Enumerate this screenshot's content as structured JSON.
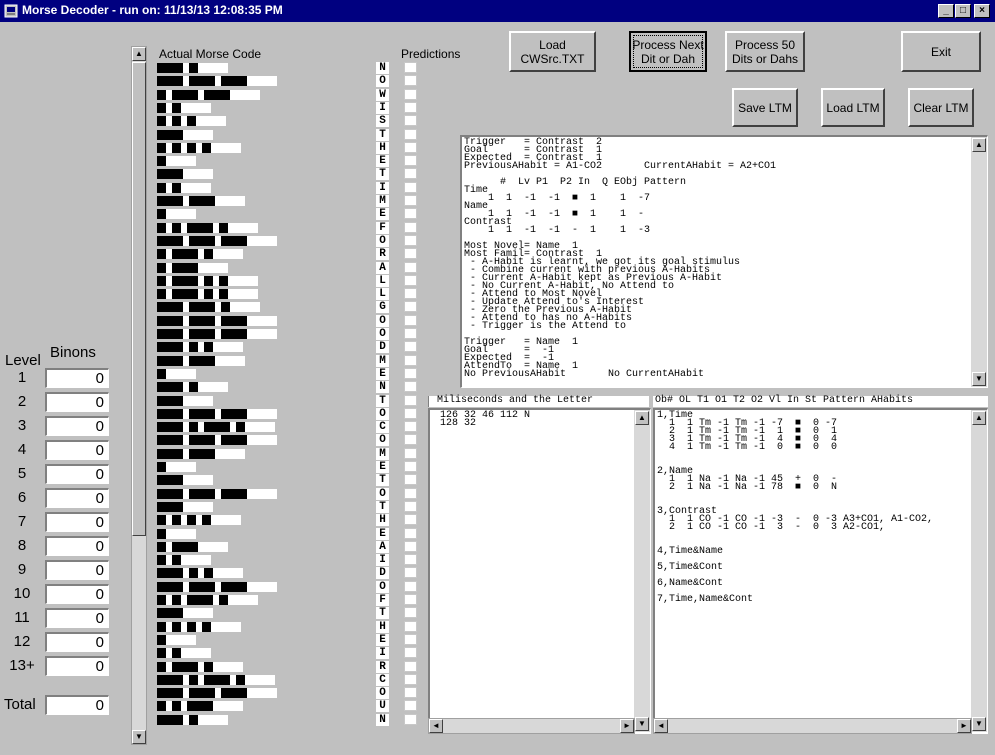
{
  "window": {
    "title": "Morse Decoder - run on: 11/13/13  12:08:35 PM",
    "min": "_",
    "max": "□",
    "close": "×"
  },
  "levels": {
    "header_level": "Level",
    "header_binons": "Binons",
    "rows": [
      {
        "label": "1",
        "value": "0"
      },
      {
        "label": "2",
        "value": "0"
      },
      {
        "label": "3",
        "value": "0"
      },
      {
        "label": "4",
        "value": "0"
      },
      {
        "label": "5",
        "value": "0"
      },
      {
        "label": "6",
        "value": "0"
      },
      {
        "label": "7",
        "value": "0"
      },
      {
        "label": "8",
        "value": "0"
      },
      {
        "label": "9",
        "value": "0"
      },
      {
        "label": "10",
        "value": "0"
      },
      {
        "label": "11",
        "value": "0"
      },
      {
        "label": "12",
        "value": "0"
      },
      {
        "label": "13+",
        "value": "0"
      }
    ],
    "total_label": "Total",
    "total_value": "0"
  },
  "morse": {
    "header": "Actual Morse Code",
    "predictions_header": "Predictions",
    "letters": [
      "N",
      "O",
      "W",
      "I",
      "S",
      "T",
      "H",
      "E",
      "T",
      "I",
      "M",
      "E",
      "F",
      "O",
      "R",
      "A",
      "L",
      "L",
      "G",
      "O",
      "O",
      "D",
      "M",
      "E",
      "N",
      "T",
      "O",
      "C",
      "O",
      "M",
      "E",
      "T",
      "O",
      "T",
      "H",
      "E",
      "A",
      "I",
      "D",
      "O",
      "F",
      "T",
      "H",
      "E",
      "I",
      "R",
      "C",
      "O",
      "U",
      "N"
    ]
  },
  "buttons": {
    "load": "Load\nCWSrc.TXT",
    "next": "Process Next\nDit or Dah",
    "p50": "Process 50\nDits or Dahs",
    "exit": "Exit",
    "save_ltm": "Save LTM",
    "load_ltm": "Load LTM",
    "clear_ltm": "Clear LTM"
  },
  "status_text": "Trigger   = Contrast  2\nGoal      = Contrast  1\nExpected  = Contrast  1\nPreviousAHabit = A1-CO2       CurrentAHabit = A2+CO1\n\n      #  Lv P1  P2 In  Q EObj Pattern\nTime\n    1  1  -1  -1  ■  1    1  -7\nName\n    1  1  -1  -1  ■  1    1  -\nContrast\n    1  1  -1  -1  -  1    1  -3\n\nMost Novel= Name  1\nMost Famil= Contrast  1\n - A-Habit is learnt, we got its goal stimulus\n - Combine current with previous A-Habits\n - Current A-Habit kept as Previous A-Habit\n - No Current A-Habit, No Attend to\n - Attend to Most Novel\n - Update Attend to's Interest\n - Zero the Previous A-Habit\n - Attend to has no A-Habits\n - Trigger is the Attend to\n\nTrigger   = Name  1\nGoal      =  -1\nExpected  =  -1\nAttendTo  = Name  1\nNo PreviousAHabit       No CurrentAHabit",
  "ms_panel": {
    "header": " Miliseconds and the Letter",
    "text": "126 32 46 112 N\n128 32"
  },
  "obj_panel": {
    "header": "Ob# OL T1 O1 T2 O2 Vl In St Pattern AHabits",
    "text": "1,Time\n  1  1 Tm -1 Tm -1 -7  ■  0 -7\n  2  1 Tm -1 Tm -1  1  ■  0  1\n  3  1 Tm -1 Tm -1  4  ■  0  4\n  4  1 Tm -1 Tm -1  0  ■  0  0\n\n\n2,Name\n  1  1 Na -1 Na -1 45  +  0  -\n  2  1 Na -1 Na -1 78  ■  0  N\n\n\n3,Contrast\n  1  1 CO -1 CO -1 -3  -  0 -3 A3+CO1, A1-CO2,\n  2  1 CO -1 CO -1  3  -  0  3 A2-CO1,\n\n\n4,Time&Name\n\n5,Time&Cont\n\n6,Name&Cont\n\n7,Time,Name&Cont"
  }
}
